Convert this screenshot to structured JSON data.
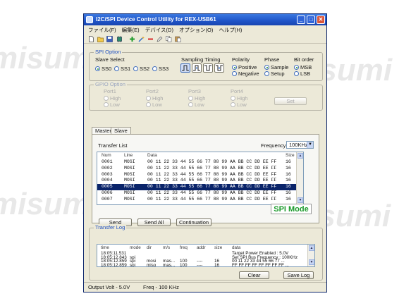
{
  "watermark": "misumi",
  "window": {
    "title": "I2C/SPI Device Control Utility for REX-USB61",
    "min_glyph": "_",
    "max_glyph": "□",
    "close_glyph": "✕"
  },
  "menu": [
    "ファイル(F)",
    "編集(E)",
    "デバイス(D)",
    "オプション(O)",
    "ヘルプ(H)"
  ],
  "toolbar_icons": [
    "new-icon",
    "open-icon",
    "save-icon",
    "chip-icon",
    "add-icon",
    "wand-icon",
    "remove-icon",
    "edit-icon",
    "copy-icon",
    "paste-icon"
  ],
  "spi_option": {
    "label": "SPI Option",
    "slave_select_label": "Slave Select",
    "slaves": [
      "SS0",
      "SS1",
      "SS2",
      "SS3"
    ],
    "slave_selected": 0,
    "timing_label": "Sampling Timing",
    "polarity_label": "Polarity",
    "polarity": [
      "Positive",
      "Negative"
    ],
    "phase_label": "Phase",
    "phase": [
      "Sample",
      "Setup"
    ],
    "bitorder_label": "Bit order",
    "bitorder": [
      "MSB",
      "LSB"
    ]
  },
  "gpio_option": {
    "label": "GPIO Option",
    "ports": [
      "Port1",
      "Port2",
      "Port3",
      "Port4"
    ],
    "high": "High",
    "low": "Low",
    "set_label": "Set"
  },
  "tabs": [
    "Master",
    "Slave"
  ],
  "transfer": {
    "list_label": "Transfer List",
    "frequency_label": "Frequency",
    "frequency_value": "100KHz",
    "columns": [
      "Num",
      "Line",
      "Data",
      "Size"
    ],
    "rows": [
      {
        "num": "0001",
        "line": "MOSI",
        "data": "00 11 22 33 44 55 66 77 88 99 AA BB CC DD EE FF",
        "size": "16"
      },
      {
        "num": "0002",
        "line": "MOSI",
        "data": "00 11 22 33 44 55 66 77 88 99 AA BB CC DD EE FF",
        "size": "16"
      },
      {
        "num": "0003",
        "line": "MOSI",
        "data": "00 11 22 33 44 55 66 77 88 99 AA BB CC DD EE FF",
        "size": "16"
      },
      {
        "num": "0004",
        "line": "MOSI",
        "data": "00 11 22 33 44 55 66 77 88 99 AA BB CC DD EE FF",
        "size": "16"
      },
      {
        "num": "0005",
        "line": "MOSI",
        "data": "00 11 22 33 44 55 66 77 88 99 AA BB CC DD EE FF",
        "size": "16"
      },
      {
        "num": "0006",
        "line": "MOSI",
        "data": "00 11 22 33 44 55 66 77 88 99 AA BB CC DD EE FF",
        "size": "16"
      },
      {
        "num": "0007",
        "line": "MOSI",
        "data": "00 11 22 33 44 55 66 77 88 99 AA BB CC DD EE FF",
        "size": "16"
      }
    ],
    "selected_row": 4,
    "send_label": "Send",
    "send_all_label": "Send All",
    "continuation_label": "Continuation",
    "mode_label": "SPI Mode"
  },
  "log": {
    "label": "Transfer Log",
    "columns": [
      "time",
      "mode",
      "dir",
      "m/s",
      "freq",
      "addr",
      "size",
      "data"
    ],
    "rows": [
      {
        "time": "18:05:11.531",
        "mode": "",
        "dir": "",
        "ms": "",
        "freq": "",
        "addr": "",
        "size": "",
        "data": "Target Power Enabled : 5.0V"
      },
      {
        "time": "18:05:12.843",
        "mode": "spi",
        "dir": "",
        "ms": "",
        "freq": "",
        "addr": "",
        "size": "",
        "data": "Set SPI Bus Frequency : 100KHz"
      },
      {
        "time": "18:05:12.859",
        "mode": "spi",
        "dir": "mosi",
        "ms": "mas...",
        "freq": "100",
        "addr": "----",
        "size": "16",
        "data": "00 11 22 33 44 55 66 77 ..."
      },
      {
        "time": "18:05:12.859",
        "mode": "spi",
        "dir": "miso",
        "ms": "mas...",
        "freq": "100",
        "addr": "----",
        "size": "16",
        "data": "FF FF FF FF FF FF FF FF ..."
      }
    ],
    "clear_label": "Clear",
    "save_label": "Save Log"
  },
  "status": {
    "volt": "Output Volt - 5.0V",
    "freq": "Freq - 100 KHz"
  }
}
